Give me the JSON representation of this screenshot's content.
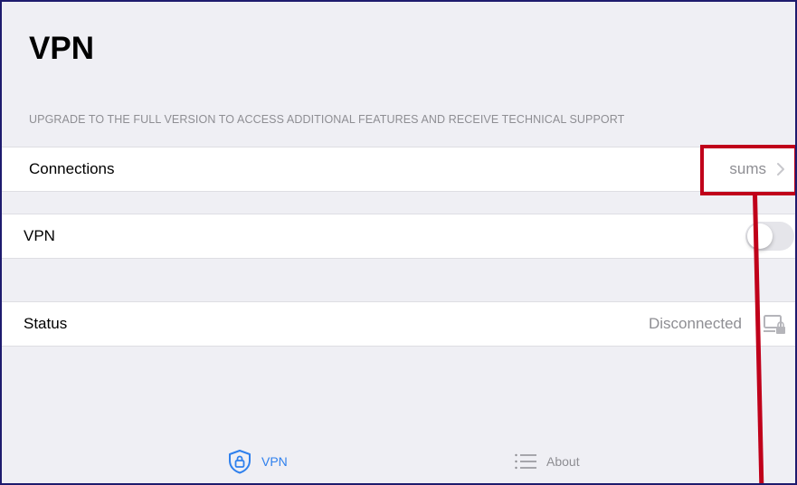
{
  "nav": {
    "title": "VPN"
  },
  "promo": {
    "text": "UPGRADE TO THE FULL VERSION TO ACCESS ADDITIONAL FEATURES AND RECEIVE TECHNICAL SUPPORT"
  },
  "connections": {
    "label": "Connections",
    "value": "sums"
  },
  "vpn_row": {
    "label": "VPN",
    "toggle_on": false
  },
  "status": {
    "label": "Status",
    "value": "Disconnected"
  },
  "tabs": [
    {
      "label": "VPN",
      "icon": "shield-lock-icon",
      "selected": true
    },
    {
      "label": "About",
      "icon": "list-icon",
      "selected": false
    }
  ],
  "colors": {
    "accent": "#2f80ed",
    "background": "#efeff4",
    "secondary_text": "#8e8e93",
    "annotation": "#c0001a"
  }
}
